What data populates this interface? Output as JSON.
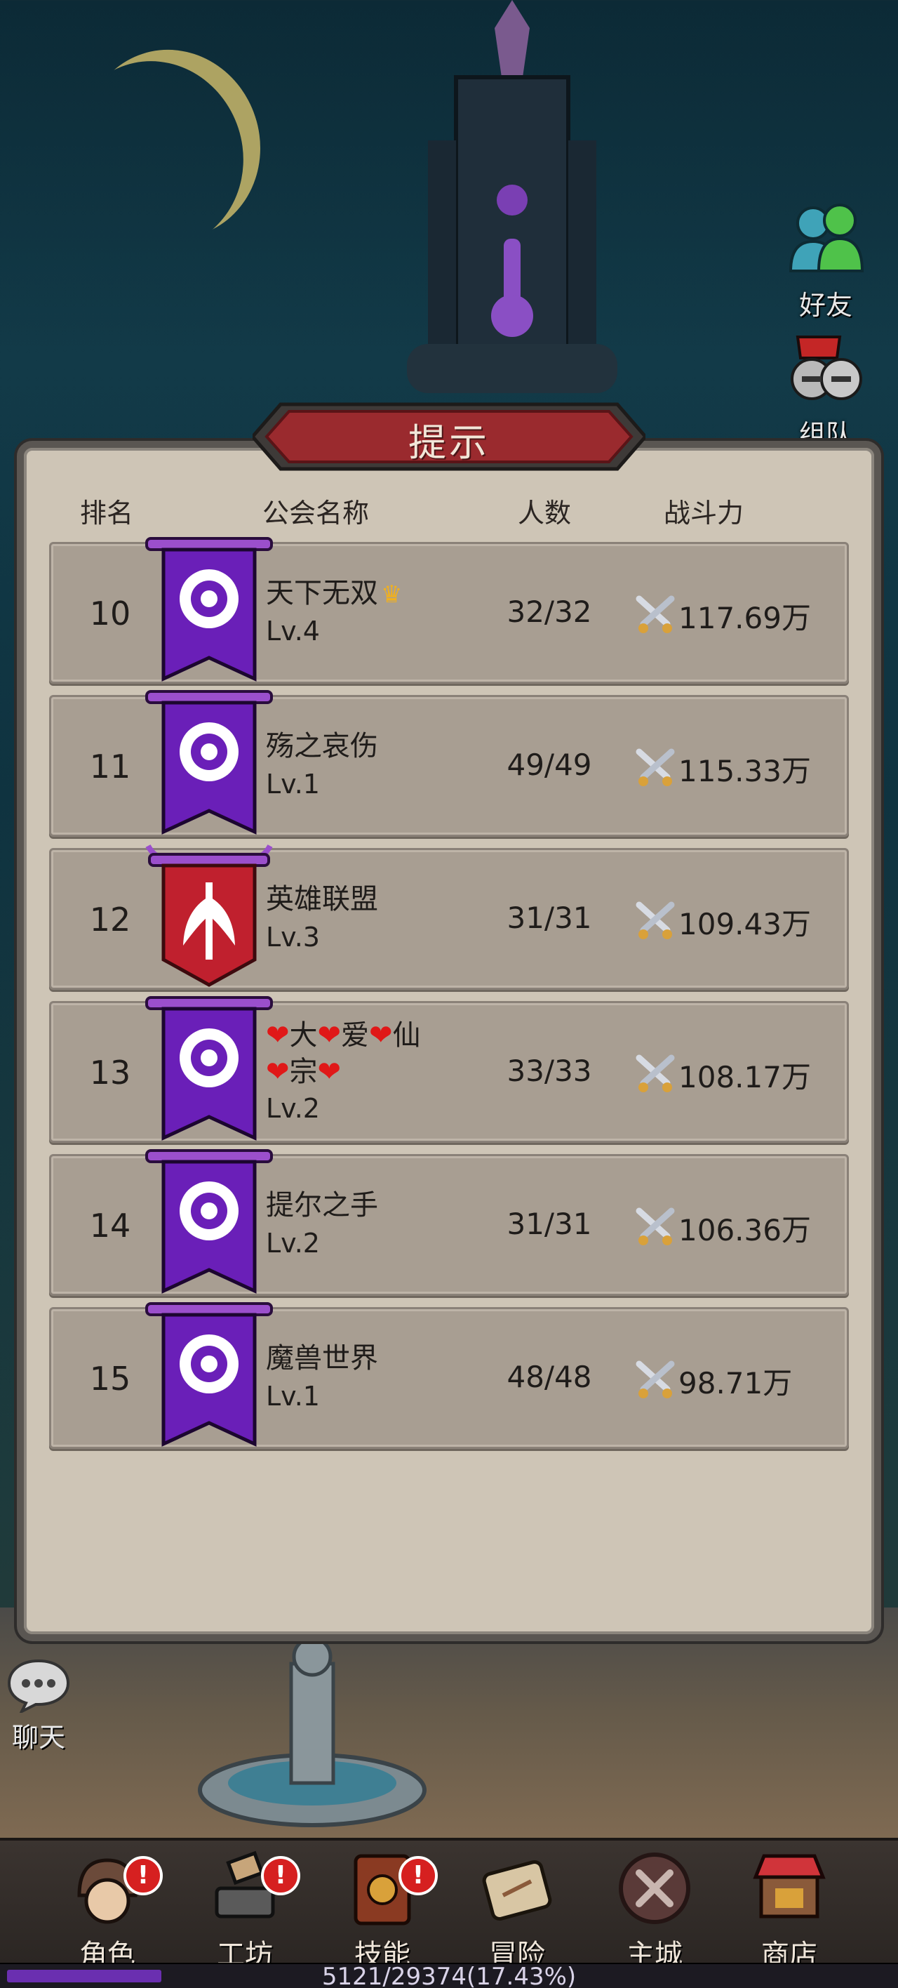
{
  "side": {
    "friends_label": "好友",
    "team_label": "组队",
    "chat_label": "聊天"
  },
  "dialog": {
    "title": "提示",
    "headers": {
      "rank": "排名",
      "guild_name": "公会名称",
      "members": "人数",
      "power": "战斗力"
    },
    "rows": [
      {
        "rank": "10",
        "name": "天下无双",
        "name_line2": "",
        "crown": true,
        "level": "Lv.4",
        "members": "32/32",
        "power": "117.69万",
        "banner": "purple"
      },
      {
        "rank": "11",
        "name": "殇之哀伤",
        "name_line2": "",
        "crown": false,
        "level": "Lv.1",
        "members": "49/49",
        "power": "115.33万",
        "banner": "purple"
      },
      {
        "rank": "12",
        "name": "英雄联盟",
        "name_line2": "",
        "crown": false,
        "level": "Lv.3",
        "members": "31/31",
        "power": "109.43万",
        "banner": "red"
      },
      {
        "rank": "13",
        "name": "❤大❤爱❤仙",
        "name_line2": "❤宗❤",
        "crown": false,
        "level": "Lv.2",
        "members": "33/33",
        "power": "108.17万",
        "banner": "purple"
      },
      {
        "rank": "14",
        "name": "提尔之手",
        "name_line2": "",
        "crown": false,
        "level": "Lv.2",
        "members": "31/31",
        "power": "106.36万",
        "banner": "purple"
      },
      {
        "rank": "15",
        "name": "魔兽世界",
        "name_line2": "",
        "crown": false,
        "level": "Lv.1",
        "members": "48/48",
        "power": "98.71万",
        "banner": "purple"
      }
    ]
  },
  "nav": {
    "items": [
      {
        "label": "角色",
        "icon": "character-icon",
        "badge": "!"
      },
      {
        "label": "工坊",
        "icon": "workshop-icon",
        "badge": "!"
      },
      {
        "label": "技能",
        "icon": "skill-book-icon",
        "badge": "!"
      },
      {
        "label": "冒险",
        "icon": "adventure-scroll-icon",
        "badge": ""
      },
      {
        "label": "主城",
        "icon": "main-city-icon",
        "badge": ""
      },
      {
        "label": "商店",
        "icon": "shop-icon",
        "badge": ""
      }
    ]
  },
  "exp": {
    "text": "5121/29374(17.43%)",
    "fraction": 0.1743
  },
  "colors": {
    "banner_purple": "#6a1fb8",
    "banner_red": "#c0202e",
    "title_red": "#9a2a2e",
    "row_bg": "#a89e92",
    "panel_bg": "#cec5b6"
  }
}
